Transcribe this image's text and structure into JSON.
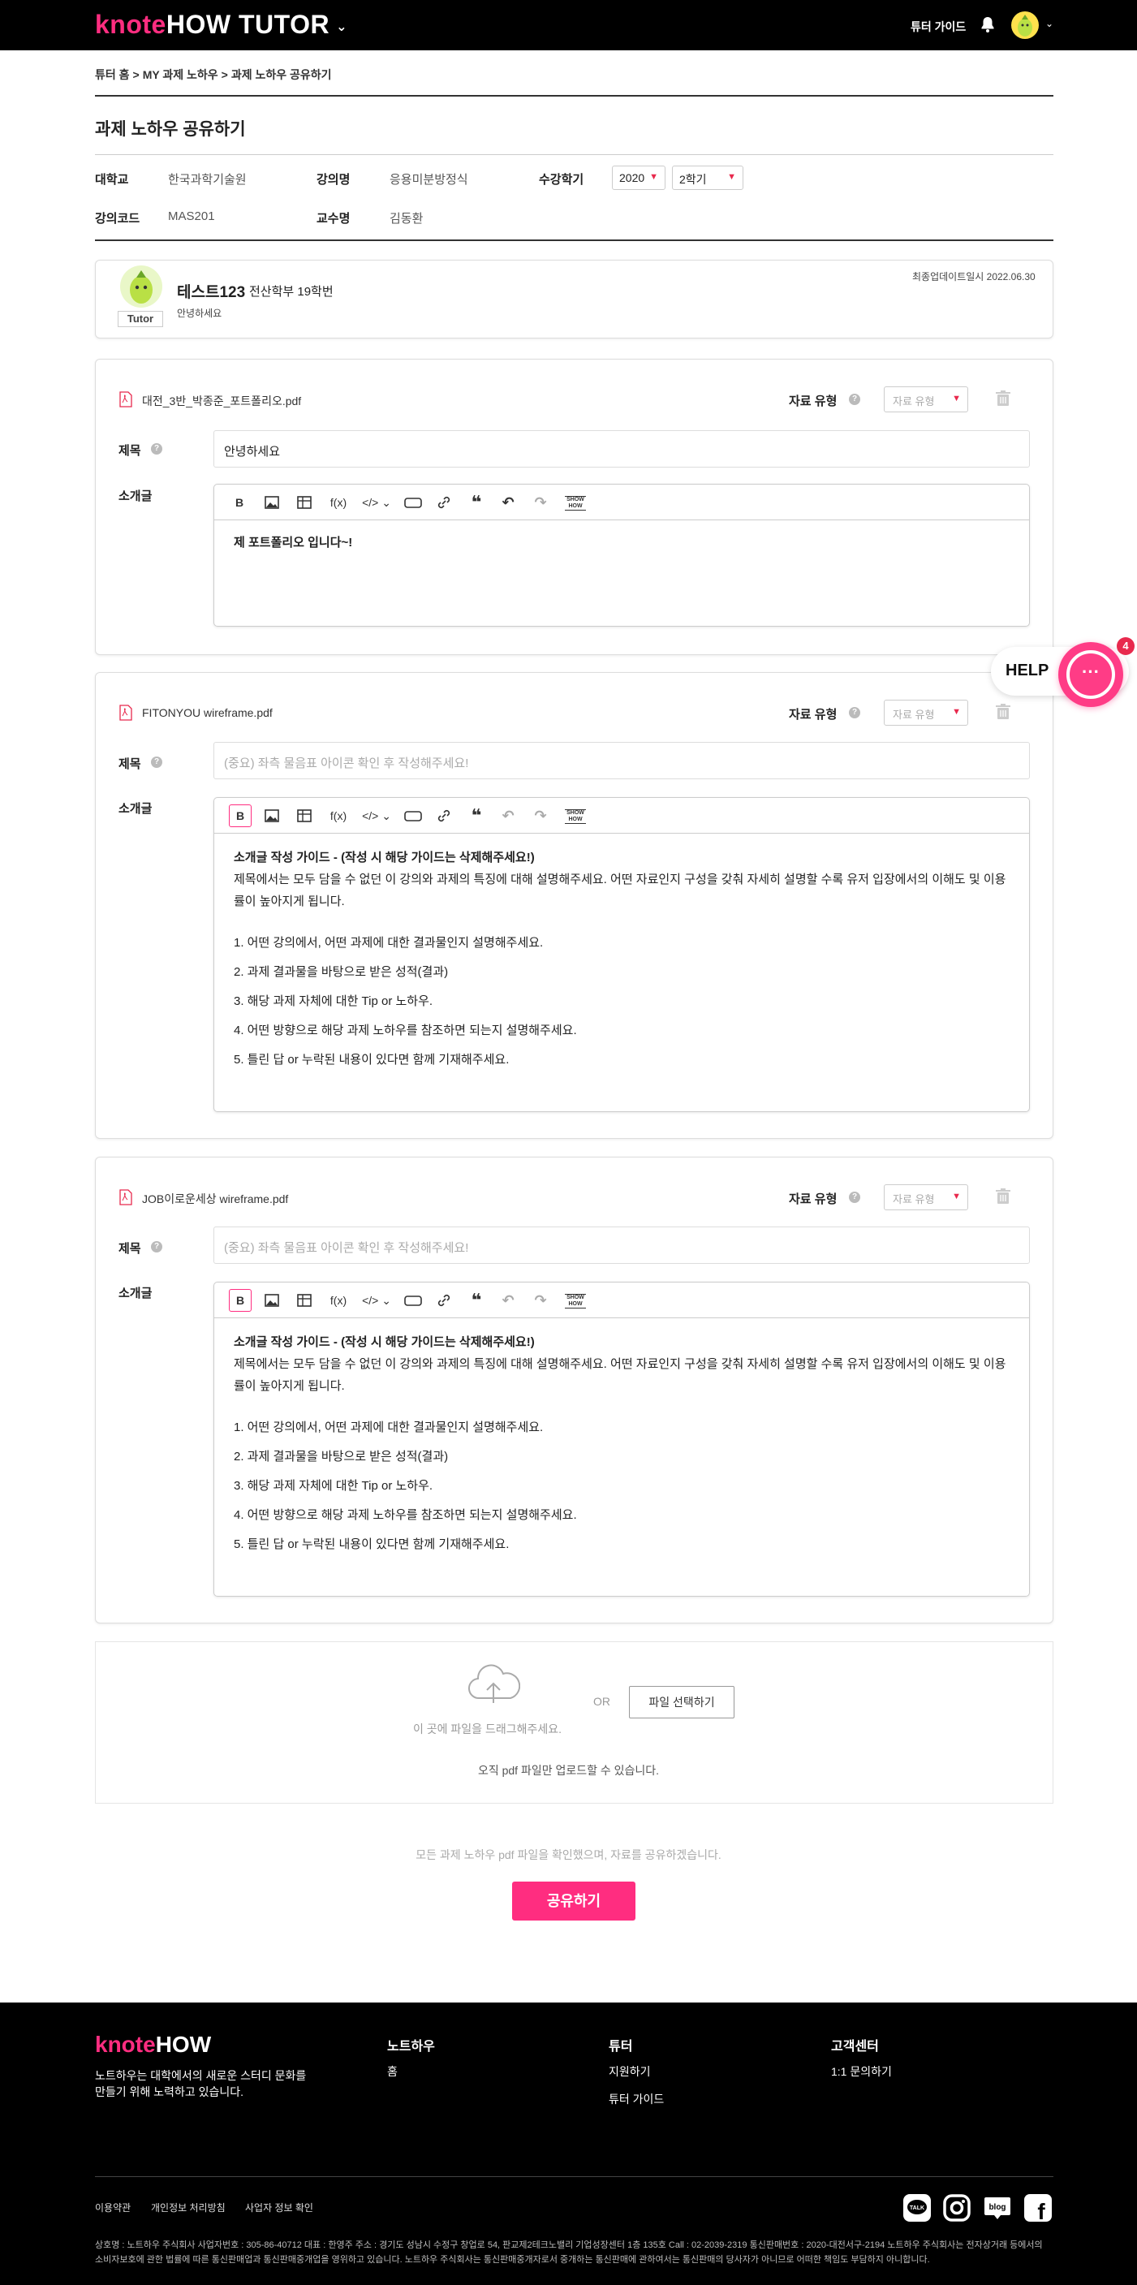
{
  "header": {
    "logo_k": "knote",
    "logo_rest": "HOW TUTOR",
    "logo_chevron": "⌄",
    "guide": "튜터 가이드",
    "icons": [
      "bell-icon",
      "avatar",
      "chevron-down-icon"
    ]
  },
  "breadcrumb": {
    "items": [
      "튜터 홈",
      "MY 과제 노하우",
      "과제 노하우 공유하기"
    ],
    "sep": ">"
  },
  "page": {
    "title": "과제 노하우 공유하기"
  },
  "info": {
    "school_label": "대학교",
    "school": "한국과학기술원",
    "course_label": "강의명",
    "course": "응용미분방정식",
    "term_label": "수강학기",
    "year": "2020",
    "semester": "2학기",
    "code_label": "강의코드",
    "code": "MAS201",
    "prof_label": "교수명",
    "prof": "김동환"
  },
  "tutor": {
    "name": "테스트123",
    "dept": "전산학부 19학번",
    "message": "안녕하세요",
    "badge": "Tutor",
    "updated": "최종업데이트일시 2022.06.30"
  },
  "common": {
    "type_label": "자료 유형",
    "type_placeholder": "자료 유형",
    "title_label": "제목",
    "intro_label": "소개글",
    "q": "?",
    "title_placeholder": "(중요) 좌측 물음표 아이콘 확인 후 작성해주세요!",
    "toolbar": {
      "bold": "B",
      "fx": "f(x)",
      "code": "</>",
      "code_chev": "⌄",
      "quote": "❝",
      "undo": "↶",
      "redo": "↷",
      "show": "SHOW HOW"
    }
  },
  "guide": {
    "title": "소개글 작성 가이드 - (작성 시 해당 가이드는 삭제해주세요!)",
    "body": "제목에서는 모두 담을 수 없던 이 강의와 과제의 특징에 대해 설명해주세요. 어떤 자료인지 구성을 갖춰 자세히 설명할 수록 유저 입장에서의 이해도 및 이용률이 높아지게 됩니다.",
    "items": [
      "1. 어떤 강의에서, 어떤 과제에 대한 결과물인지 설명해주세요.",
      "2. 과제 결과물을 바탕으로 받은 성적(결과)",
      "3. 해당 과제 자체에 대한 Tip or 노하우.",
      "4. 어떤 방향으로 해당 과제 노하우를 참조하면 되는지 설명해주세요.",
      "5. 틀린 답 or 누락된 내용이 있다면 함께 기재해주세요."
    ]
  },
  "files": [
    {
      "name": "대전_3반_박종준_포트폴리오.pdf",
      "title": "안녕하세요",
      "intro": "제 포트폴리오 입니다~!"
    },
    {
      "name": "FITONYOU wireframe.pdf",
      "title": ""
    },
    {
      "name": "JOB이로운세상 wireframe.pdf",
      "title": ""
    }
  ],
  "upload": {
    "drop_text": "이 곳에 파일을 드래그해주세요.",
    "or": "OR",
    "select_button": "파일 선택하기",
    "only_pdf": "오직 pdf 파일만 업로드할 수 있습니다."
  },
  "confirm_text": "모든 과제 노하우 pdf 파일을 확인했으며, 자료를 공유하겠습니다.",
  "share_button": "공유하기",
  "help": {
    "label": "HELP",
    "badge": "4",
    "dots": "···"
  },
  "footer": {
    "logo_k": "knote",
    "logo_rest": "HOW",
    "desc_line1": "노트하우는 대학에서의 새로운 스터디 문화를",
    "desc_line2": "만들기 위해 노력하고 있습니다.",
    "col1_title": "노트하우",
    "col1_links": [
      "홈"
    ],
    "col2_title": "튜터",
    "col2_links": [
      "지원하기",
      "튜터 가이드"
    ],
    "col3_title": "고객센터",
    "col3_links": [
      "1:1 문의하기"
    ],
    "bottom_links": [
      "이용약관",
      "개인정보 처리방침",
      "사업자 정보 확인"
    ],
    "sns": [
      "kakao-talk-icon",
      "instagram-icon",
      "blog-icon",
      "facebook-icon"
    ],
    "sns_talk": "TALK",
    "sns_blog": "blog",
    "sns_fb": "f",
    "legal_line1": "상호명 : 노트하우 주식회사 사업자번호 : 305-86-40712 대표 : 한영주 주소 : 경기도 성남시 수정구 창업로 54, 판교제2테크노밸리 기업성장센터 1층 135호 Call : 02-2039-2319 통신판매번호 : 2020-대전서구-2194 노트하우 주식회사는 전자상거래 등에서의",
    "legal_line2": "소비자보호에 관한 법률에 따른 통신판매업과 통신판매중개업을 영위하고 있습니다. 노트하우 주식회사는 통신판매중개자로서 중개하는 통신판매에 관하여서는 통신판매의 당사자가 아니므로 어떠한 책임도 부담하지 아니합니다."
  }
}
